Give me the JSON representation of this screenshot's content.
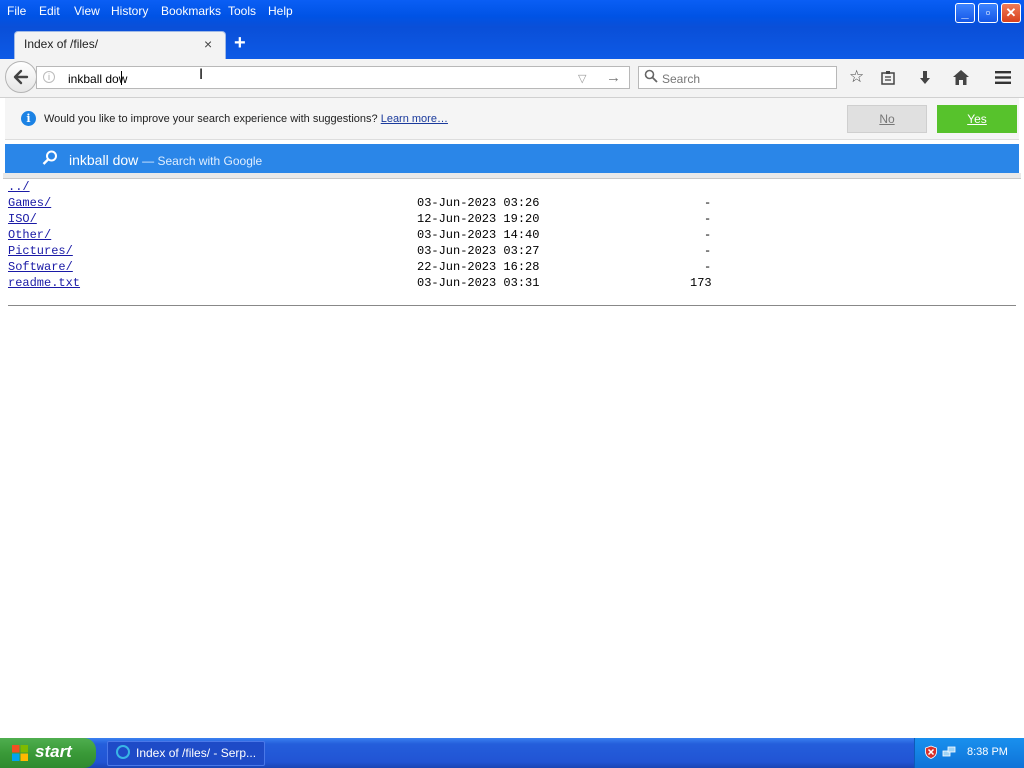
{
  "menu": {
    "items": [
      {
        "label": "File"
      },
      {
        "label": "Edit"
      },
      {
        "label": "View"
      },
      {
        "label": "History"
      },
      {
        "label": "Bookmarks"
      },
      {
        "label": "Tools"
      },
      {
        "label": "Help"
      }
    ]
  },
  "window_controls": {
    "minimize": "_",
    "maximize": "▫",
    "close": "✕"
  },
  "tab": {
    "title": "Index of /files/",
    "close_glyph": "×",
    "new_tab_glyph": "+"
  },
  "urlbar": {
    "value": "inkball dow"
  },
  "searchbar": {
    "placeholder": "Search"
  },
  "notification": {
    "message": "Would you like to improve your search experience with suggestions?",
    "link": "Learn more…",
    "no_label": "No",
    "yes_label": "Yes"
  },
  "suggestion": {
    "query": "inkball dow",
    "action": "— Search with Google"
  },
  "listing": {
    "parent": "../",
    "rows": [
      {
        "name": "Games/",
        "date": "03-Jun-2023 03:26",
        "size": "-"
      },
      {
        "name": "ISO/",
        "date": "12-Jun-2023 19:20",
        "size": "-"
      },
      {
        "name": "Other/",
        "date": "03-Jun-2023 14:40",
        "size": "-"
      },
      {
        "name": "Pictures/",
        "date": "03-Jun-2023 03:27",
        "size": "-"
      },
      {
        "name": "Software/",
        "date": "22-Jun-2023 16:28",
        "size": "-"
      },
      {
        "name": "readme.txt",
        "date": "03-Jun-2023 03:31",
        "size": "173"
      }
    ]
  },
  "taskbar": {
    "start_label": "start",
    "task_label": "Index of /files/ - Serp...",
    "clock": "8:38 PM"
  },
  "colors": {
    "accent": "#2a86e8",
    "yes_button": "#57c22c",
    "link": "#1a1aa6"
  }
}
